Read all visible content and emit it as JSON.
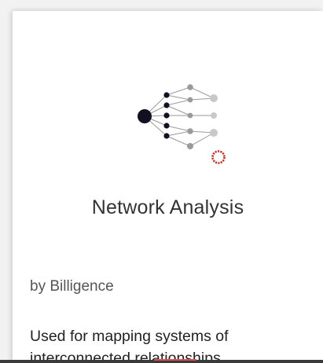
{
  "extension": {
    "logo_icon": "network-graph-icon",
    "badge_icon": "red-ring-icon",
    "title": "Network Analysis",
    "author": "by Billigence",
    "description": "Used for mapping systems of interconnected relationships.",
    "colors": {
      "node_dark": "#111122",
      "node_mid": "#9a9a9a",
      "node_light": "#c8c8c8",
      "badge": "#c0392b"
    }
  }
}
